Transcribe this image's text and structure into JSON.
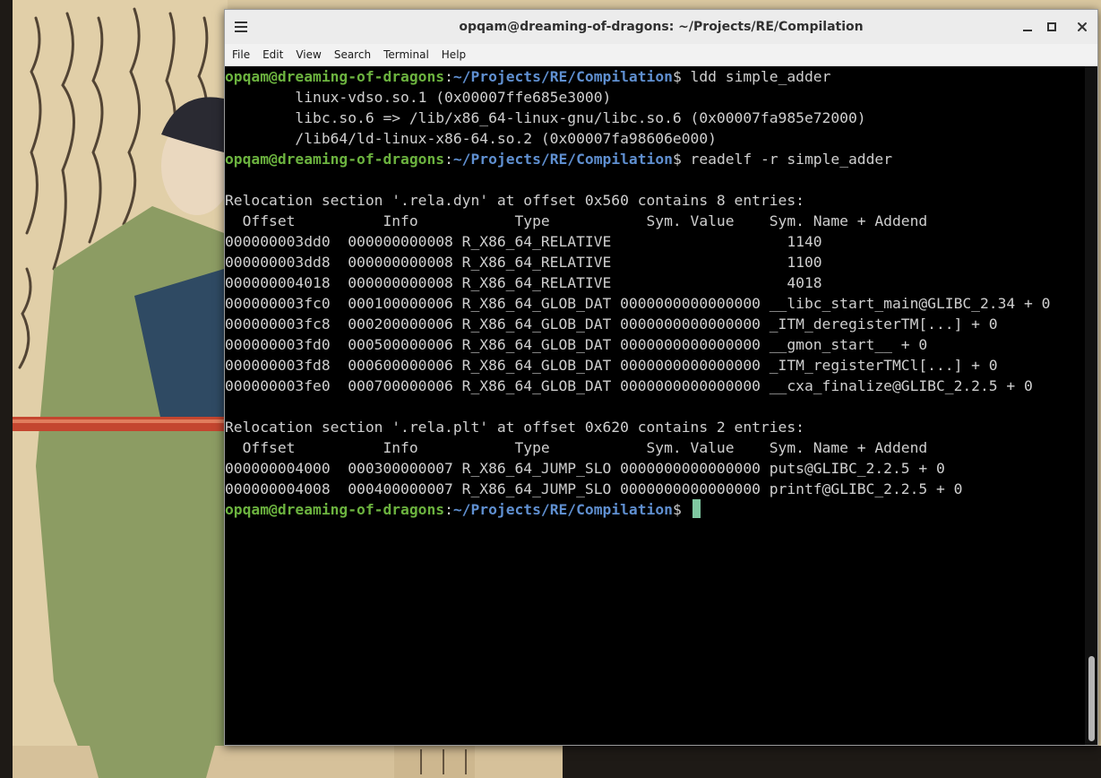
{
  "window": {
    "title": "opqam@dreaming-of-dragons: ~/Projects/RE/Compilation"
  },
  "menu": [
    "File",
    "Edit",
    "View",
    "Search",
    "Terminal",
    "Help"
  ],
  "prompt": {
    "user_host": "opqam@dreaming-of-dragons",
    "colon": ":",
    "path": "~/Projects/RE/Compilation",
    "symbol": "$"
  },
  "terminal_lines": [
    {
      "type": "prompt",
      "command": " ldd simple_adder"
    },
    {
      "type": "text",
      "text": "        linux-vdso.so.1 (0x00007ffe685e3000)"
    },
    {
      "type": "text",
      "text": "        libc.so.6 => /lib/x86_64-linux-gnu/libc.so.6 (0x00007fa985e72000)"
    },
    {
      "type": "text",
      "text": "        /lib64/ld-linux-x86-64.so.2 (0x00007fa98606e000)"
    },
    {
      "type": "prompt",
      "command": " readelf -r simple_adder"
    },
    {
      "type": "text",
      "text": ""
    },
    {
      "type": "text",
      "text": "Relocation section '.rela.dyn' at offset 0x560 contains 8 entries:"
    },
    {
      "type": "text",
      "text": "  Offset          Info           Type           Sym. Value    Sym. Name + Addend"
    },
    {
      "type": "text",
      "text": "000000003dd0  000000000008 R_X86_64_RELATIVE                    1140"
    },
    {
      "type": "text",
      "text": "000000003dd8  000000000008 R_X86_64_RELATIVE                    1100"
    },
    {
      "type": "text",
      "text": "000000004018  000000000008 R_X86_64_RELATIVE                    4018"
    },
    {
      "type": "text",
      "text": "000000003fc0  000100000006 R_X86_64_GLOB_DAT 0000000000000000 __libc_start_main@GLIBC_2.34 + 0"
    },
    {
      "type": "text",
      "text": "000000003fc8  000200000006 R_X86_64_GLOB_DAT 0000000000000000 _ITM_deregisterTM[...] + 0"
    },
    {
      "type": "text",
      "text": "000000003fd0  000500000006 R_X86_64_GLOB_DAT 0000000000000000 __gmon_start__ + 0"
    },
    {
      "type": "text",
      "text": "000000003fd8  000600000006 R_X86_64_GLOB_DAT 0000000000000000 _ITM_registerTMCl[...] + 0"
    },
    {
      "type": "text",
      "text": "000000003fe0  000700000006 R_X86_64_GLOB_DAT 0000000000000000 __cxa_finalize@GLIBC_2.2.5 + 0"
    },
    {
      "type": "text",
      "text": ""
    },
    {
      "type": "text",
      "text": "Relocation section '.rela.plt' at offset 0x620 contains 2 entries:"
    },
    {
      "type": "text",
      "text": "  Offset          Info           Type           Sym. Value    Sym. Name + Addend"
    },
    {
      "type": "text",
      "text": "000000004000  000300000007 R_X86_64_JUMP_SLO 0000000000000000 puts@GLIBC_2.2.5 + 0"
    },
    {
      "type": "text",
      "text": "000000004008  000400000007 R_X86_64_JUMP_SLO 0000000000000000 printf@GLIBC_2.2.5 + 0"
    },
    {
      "type": "prompt",
      "command": " ",
      "cursor": true
    }
  ],
  "icons": {
    "menu": "hamburger-icon",
    "minimize": "minimize-icon",
    "maximize": "maximize-icon",
    "close": "close-icon"
  },
  "colors": {
    "prompt_user": "#6cb33f",
    "prompt_path": "#5f8fd0",
    "terminal_text": "#cfcfcf",
    "terminal_bg": "#000000",
    "cursor": "#7fc8a1"
  }
}
